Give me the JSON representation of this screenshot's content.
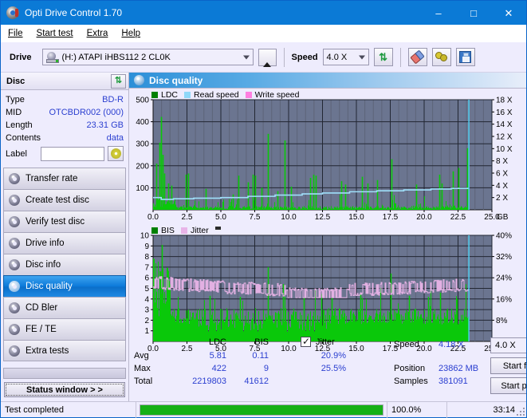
{
  "window": {
    "title": "Opti Drive Control 1.70",
    "icon": "disc-icon",
    "minimize": "–",
    "maximize": "□",
    "close": "✕"
  },
  "menu": [
    {
      "label": "File"
    },
    {
      "label": "Start test"
    },
    {
      "label": "Extra"
    },
    {
      "label": "Help"
    }
  ],
  "toolbar": {
    "drive_label": "Drive",
    "drive_value": "(H:)  ATAPI iHBS112  2 CL0K",
    "eject_icon": "eject-icon",
    "speed_label": "Speed",
    "speed_value": "4.0 X",
    "refresh_icon": "refresh-icon",
    "eraser_icon": "eraser-icon",
    "tools_icon": "tools-icon",
    "save_icon": "save-icon"
  },
  "sidebar": {
    "disc_header": "Disc",
    "disc_refresh_icon": "refresh-icon",
    "disc_info": [
      {
        "key": "Type",
        "value": "BD-R"
      },
      {
        "key": "MID",
        "value": "OTCBDR002 (000)"
      },
      {
        "key": "Length",
        "value": "23.31 GB"
      },
      {
        "key": "Contents",
        "value": "data"
      }
    ],
    "label_key": "Label",
    "label_value": "",
    "label_button_icon": "cd-icon",
    "nav": [
      {
        "label": "Transfer rate",
        "active": false
      },
      {
        "label": "Create test disc",
        "active": false
      },
      {
        "label": "Verify test disc",
        "active": false
      },
      {
        "label": "Drive info",
        "active": false
      },
      {
        "label": "Disc info",
        "active": false
      },
      {
        "label": "Disc quality",
        "active": true
      },
      {
        "label": "CD Bler",
        "active": false
      },
      {
        "label": "FE / TE",
        "active": false
      },
      {
        "label": "Extra tests",
        "active": false
      }
    ],
    "status_button": "Status window > >"
  },
  "main": {
    "pane_title": "Disc quality",
    "pane_icon": "disc-quality-icon"
  },
  "stats": {
    "col_headers": [
      "LDC",
      "BIS"
    ],
    "jitter_label": "Jitter",
    "jitter_checked": true,
    "rows": [
      {
        "key": "Avg",
        "ldc": "5.81",
        "bis": "0.11",
        "jitter": "20.9%"
      },
      {
        "key": "Max",
        "ldc": "422",
        "bis": "9",
        "jitter": "25.5%"
      },
      {
        "key": "Total",
        "ldc": "2219803",
        "bis": "41612",
        "jitter": ""
      }
    ],
    "speed_key": "Speed",
    "speed_value": "4.18 X",
    "position_key": "Position",
    "position_value": "23862 MB",
    "samples_key": "Samples",
    "samples_value": "381091",
    "speed_select": "4.0 X",
    "start_full": "Start full",
    "start_part": "Start part"
  },
  "statusbar": {
    "message": "Test completed",
    "percent_label": "100.0%",
    "percent_value": 100,
    "elapsed": "33:14"
  },
  "chart_data": [
    {
      "type": "area",
      "name": "ldc-chart",
      "title": "",
      "legend": [
        {
          "label": "LDC",
          "color": "#008000"
        },
        {
          "label": "Read speed",
          "color": "#8fd8f8"
        },
        {
          "label": "Write speed",
          "color": "#ff7fe0"
        }
      ],
      "xlabel": "GB",
      "xticks": [
        "0.0",
        "2.5",
        "5.0",
        "7.5",
        "10.0",
        "12.5",
        "15.0",
        "17.5",
        "20.0",
        "22.5",
        "25.0"
      ],
      "xlim": [
        0,
        25
      ],
      "ylabel_left": "LDC",
      "yticks_left": [
        "100",
        "200",
        "300",
        "400",
        "500"
      ],
      "ylim_left": [
        0,
        500
      ],
      "ylabel_right": "Speed",
      "yticks_right": [
        "2 X",
        "4 X",
        "6 X",
        "8 X",
        "10 X",
        "12 X",
        "14 X",
        "16 X",
        "18 X"
      ],
      "ylim_right": [
        0,
        18
      ],
      "grid": true,
      "data_end_gb": 23.3,
      "ldc_avg": 5.81,
      "ldc_max": 422,
      "ldc_spikes": [
        {
          "x": 0.25,
          "y": 210
        },
        {
          "x": 0.45,
          "y": 305
        },
        {
          "x": 0.6,
          "y": 422
        },
        {
          "x": 0.72,
          "y": 250
        },
        {
          "x": 0.85,
          "y": 165
        },
        {
          "x": 1.1,
          "y": 120
        },
        {
          "x": 1.35,
          "y": 110
        },
        {
          "x": 2.4,
          "y": 160
        },
        {
          "x": 2.6,
          "y": 165
        },
        {
          "x": 3.9,
          "y": 95
        },
        {
          "x": 5.9,
          "y": 70
        },
        {
          "x": 6.3,
          "y": 155
        },
        {
          "x": 7.0,
          "y": 125
        },
        {
          "x": 7.35,
          "y": 160
        },
        {
          "x": 7.5,
          "y": 155
        },
        {
          "x": 8.0,
          "y": 100
        },
        {
          "x": 8.45,
          "y": 345
        },
        {
          "x": 9.2,
          "y": 85
        },
        {
          "x": 9.7,
          "y": 315
        },
        {
          "x": 10.2,
          "y": 105
        },
        {
          "x": 11.6,
          "y": 145
        },
        {
          "x": 11.8,
          "y": 160
        },
        {
          "x": 12.0,
          "y": 155
        },
        {
          "x": 13.9,
          "y": 130
        },
        {
          "x": 14.2,
          "y": 115
        },
        {
          "x": 15.4,
          "y": 150
        },
        {
          "x": 15.8,
          "y": 120
        },
        {
          "x": 16.5,
          "y": 135
        },
        {
          "x": 17.6,
          "y": 230
        },
        {
          "x": 19.4,
          "y": 115
        },
        {
          "x": 21.1,
          "y": 160
        },
        {
          "x": 21.3,
          "y": 120
        },
        {
          "x": 22.1,
          "y": 175
        },
        {
          "x": 22.5,
          "y": 190
        },
        {
          "x": 23.2,
          "y": 280
        }
      ],
      "read_speed_steps": [
        {
          "x": 0.0,
          "v": 2.0
        },
        {
          "x": 0.6,
          "v": 1.7
        },
        {
          "x": 1.5,
          "v": 1.8
        },
        {
          "x": 3.0,
          "v": 1.9
        },
        {
          "x": 5.0,
          "v": 2.0
        },
        {
          "x": 7.0,
          "v": 2.2
        },
        {
          "x": 9.0,
          "v": 2.4
        },
        {
          "x": 11.0,
          "v": 2.6
        },
        {
          "x": 12.5,
          "v": 2.75
        },
        {
          "x": 14.5,
          "v": 2.95
        },
        {
          "x": 16.5,
          "v": 3.1
        },
        {
          "x": 18.5,
          "v": 3.25
        },
        {
          "x": 20.5,
          "v": 3.4
        },
        {
          "x": 22.0,
          "v": 3.5
        },
        {
          "x": 23.3,
          "v": 3.5
        }
      ],
      "end_marker_gb": 23.3
    },
    {
      "type": "area",
      "name": "bis-jitter-chart",
      "title": "",
      "legend": [
        {
          "label": "BIS",
          "color": "#008000"
        },
        {
          "label": "Jitter",
          "color": "#e8b4e8"
        }
      ],
      "xlabel": "GB",
      "xticks": [
        "0.0",
        "2.5",
        "5.0",
        "7.5",
        "10.0",
        "12.5",
        "15.0",
        "17.5",
        "20.0",
        "22.5",
        "25.0"
      ],
      "xlim": [
        0,
        25
      ],
      "ylabel_left": "BIS",
      "yticks_left": [
        "1",
        "2",
        "3",
        "4",
        "5",
        "6",
        "7",
        "8",
        "9",
        "10"
      ],
      "ylim_left": [
        0,
        10
      ],
      "ylabel_right": "Jitter",
      "yticks_right": [
        "8%",
        "16%",
        "24%",
        "32%",
        "40%"
      ],
      "ylim_right": [
        0,
        40
      ],
      "grid": true,
      "data_end_gb": 23.3,
      "bis_avg": 0.11,
      "bis_max": 9,
      "jitter_avg": 20.9,
      "jitter_max": 25.5,
      "end_marker_gb": 23.3
    }
  ]
}
